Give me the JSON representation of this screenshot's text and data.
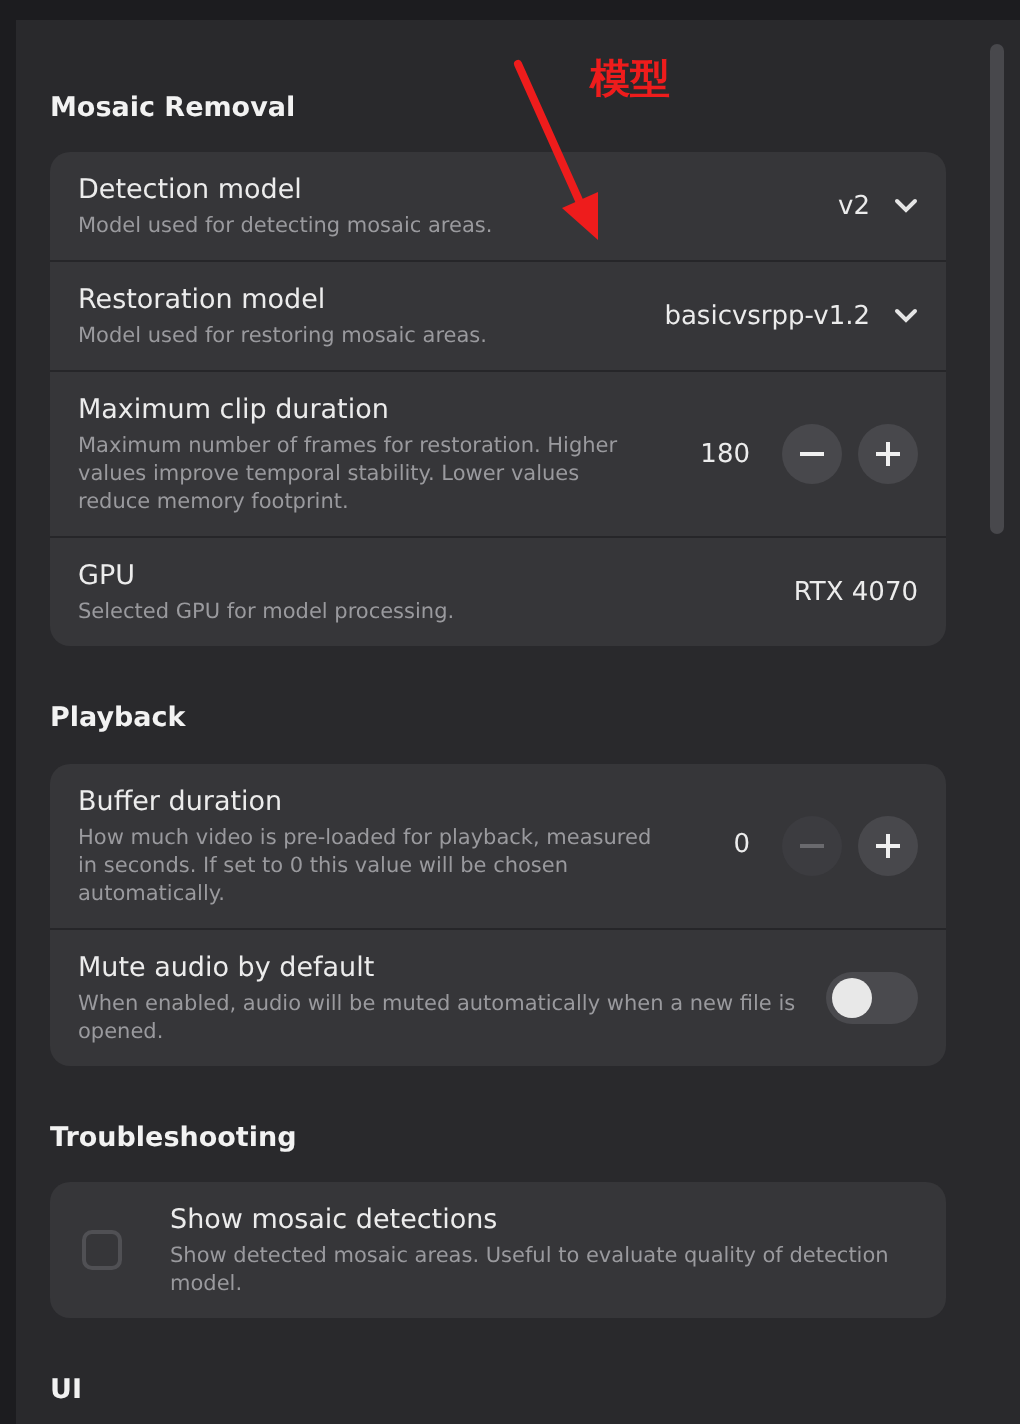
{
  "annotation": {
    "text": "模型"
  },
  "sections": [
    {
      "title": "Mosaic Removal",
      "rows": [
        {
          "kind": "select",
          "title": "Detection model",
          "description": "Model used for detecting mosaic areas.",
          "value": "v2"
        },
        {
          "kind": "select",
          "title": "Restoration model",
          "description": "Model used for restoring mosaic areas.",
          "value": "basicvsrpp-v1.2"
        },
        {
          "kind": "stepper",
          "title": "Maximum clip duration",
          "description": "Maximum number of frames for restoration. Higher values improve temporal stability. Lower values reduce memory footprint.",
          "value": "180",
          "minus_disabled": false
        },
        {
          "kind": "text",
          "title": "GPU",
          "description": "Selected GPU for model processing.",
          "value": "RTX 4070"
        }
      ]
    },
    {
      "title": "Playback",
      "rows": [
        {
          "kind": "stepper",
          "title": "Buffer duration",
          "description": "How much video is pre-loaded for playback, measured in seconds. If set to 0 this value will be chosen automatically.",
          "value": "0",
          "minus_disabled": true
        },
        {
          "kind": "toggle",
          "title": "Mute audio by default",
          "description": "When enabled, audio will be muted automatically when a new file is opened.",
          "on": false
        }
      ]
    },
    {
      "title": "Troubleshooting",
      "rows": [
        {
          "kind": "checkbox",
          "title": "Show mosaic detections",
          "description": "Show detected mosaic areas. Useful to evaluate quality of detection model.",
          "checked": false
        }
      ]
    },
    {
      "title": "UI"
    }
  ]
}
